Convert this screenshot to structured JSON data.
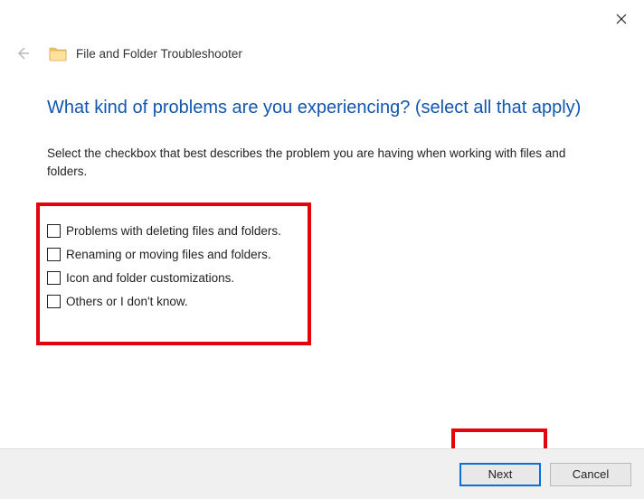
{
  "window": {
    "title": "File and Folder Troubleshooter"
  },
  "heading": "What kind of problems are you experiencing? (select all that apply)",
  "subtext": "Select the checkbox that best describes the problem you are having when working with files and folders.",
  "options": [
    {
      "label": "Problems with deleting files and folders."
    },
    {
      "label": "Renaming or moving files and folders."
    },
    {
      "label": "Icon and folder customizations."
    },
    {
      "label": "Others or I don't know."
    }
  ],
  "buttons": {
    "next": "Next",
    "cancel": "Cancel"
  }
}
